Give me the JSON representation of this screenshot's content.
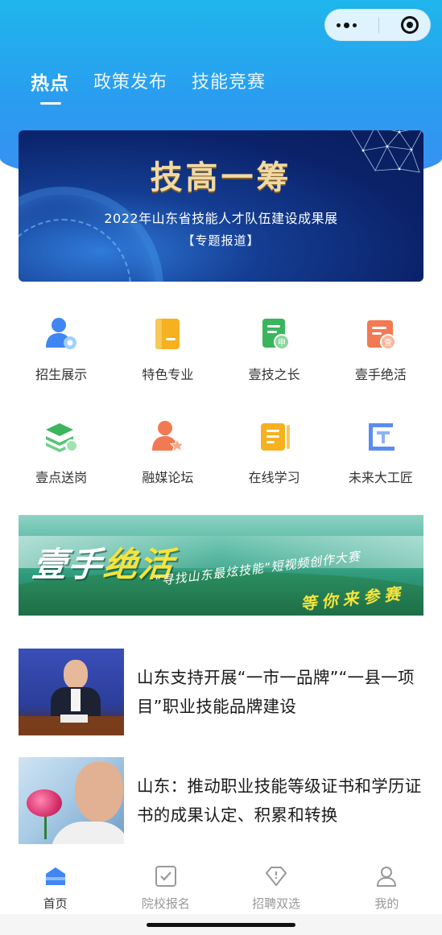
{
  "header": {
    "tabs": [
      {
        "label": "热点",
        "active": true
      },
      {
        "label": "政策发布",
        "active": false
      },
      {
        "label": "技能竞赛",
        "active": false
      }
    ]
  },
  "capsule": {
    "more_icon": "more-dots-icon",
    "close_icon": "target-circle-icon"
  },
  "hero_banner": {
    "title": "技高一筹",
    "subtitle": "2022年山东省技能人才队伍建设成果展",
    "tag": "【专题报道】"
  },
  "shortcuts": [
    {
      "label": "招生展示",
      "icon": "person-badge-icon",
      "color": "#3f86f2"
    },
    {
      "label": "特色专业",
      "icon": "book-icon",
      "color": "#f5b120"
    },
    {
      "label": "壹技之长",
      "icon": "doc-seal-icon",
      "color": "#3bb55c"
    },
    {
      "label": "壹手绝活",
      "icon": "cert-icon",
      "color": "#f27a52"
    },
    {
      "label": "壹点送岗",
      "icon": "layers-icon",
      "color": "#3bb55c"
    },
    {
      "label": "融媒论坛",
      "icon": "person-star-icon",
      "color": "#f27a52"
    },
    {
      "label": "在线学习",
      "icon": "notebook-icon",
      "color": "#f5b120"
    },
    {
      "label": "未来大工匠",
      "icon": "craftsman-icon",
      "color": "#5b8cf2"
    }
  ],
  "promo_banner": {
    "title_part1": "壹手",
    "title_part2": "绝活",
    "subtitle": "“寻找山东最炫技能”短视频创作大赛",
    "cta": "等你来参赛"
  },
  "news": [
    {
      "title": "山东支持开展“一市一品牌”“一县一项目”职业技能品牌建设"
    },
    {
      "title": "山东：推动职业技能等级证书和学历证书的成果认定、积累和转换"
    }
  ],
  "tabbar": [
    {
      "label": "首页",
      "icon": "home-icon",
      "active": true
    },
    {
      "label": "院校报名",
      "icon": "checkbox-icon",
      "active": false
    },
    {
      "label": "招聘双选",
      "icon": "diamond-icon",
      "active": false
    },
    {
      "label": "我的",
      "icon": "user-icon",
      "active": false
    }
  ],
  "colors": {
    "header_blue": "#2a9cf0",
    "active_tab": "#3f86f2",
    "inactive_tab": "#999999"
  }
}
